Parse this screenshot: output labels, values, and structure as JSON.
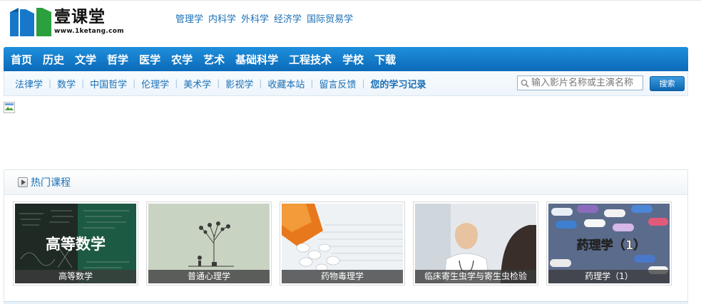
{
  "logo": {
    "name": "壹课堂",
    "url": "www.1ketang.com"
  },
  "top_links": [
    "管理学",
    "内科学",
    "外科学",
    "经济学",
    "国际贸易学"
  ],
  "main_nav": [
    "首页",
    "历史",
    "文学",
    "哲学",
    "医学",
    "农学",
    "艺术",
    "基础科学",
    "工程技术",
    "学校",
    "下载"
  ],
  "sub_nav": [
    "法律学",
    "数学",
    "中国哲学",
    "伦理学",
    "美术学",
    "影视学",
    "收藏本站",
    "留言反馈",
    "您的学习记录"
  ],
  "search": {
    "placeholder": "输入影片名称或主演名称",
    "button": "搜索"
  },
  "hot": {
    "title": "热门课程",
    "courses": [
      {
        "caption": "高等数学",
        "thumb_text": "高等数学"
      },
      {
        "caption": "普通心理学"
      },
      {
        "caption": "药物毒理学"
      },
      {
        "caption": "临床寄生虫学与寄生虫检验"
      },
      {
        "caption": "药理学（1）",
        "thumb_text": "药理学（1）"
      }
    ]
  },
  "colors": {
    "nav_blue": "#0b6ab8",
    "link_blue": "#1a6fb5"
  }
}
